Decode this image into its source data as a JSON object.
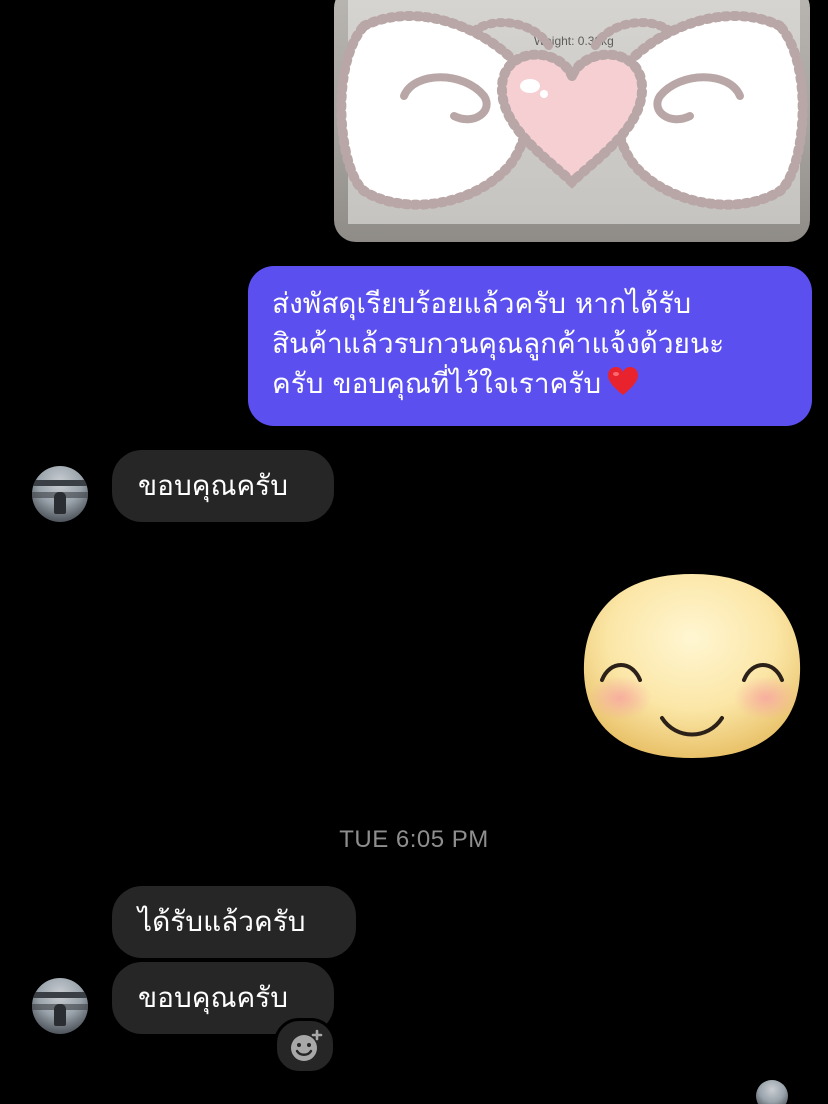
{
  "photo_message": {
    "weight_text": "Weight: 0.32kg"
  },
  "outgoing_message": {
    "lines": [
      "ส่งพัสดุเรียบร้อยแล้วครับ หากได้รับ",
      "สินค้าแล้วรบกวนคุณลูกค้าแจ้งด้วยนะ",
      "ครับ ขอบคุณที่ไว้ใจเราครับ"
    ],
    "emoji": "red-heart"
  },
  "incoming_1": {
    "text": "ขอบคุณครับ"
  },
  "sticker": {
    "icon": "smiling-face-sticker"
  },
  "timestamp": "TUE 6:05 PM",
  "incoming_2": {
    "text": "ได้รับแล้วครับ"
  },
  "incoming_3": {
    "text": "ขอบคุณครับ"
  },
  "colors": {
    "background": "#000000",
    "outgoing_bubble": "#5b50ef",
    "incoming_bubble": "#262626",
    "timestamp_text": "#8e8e8e"
  }
}
